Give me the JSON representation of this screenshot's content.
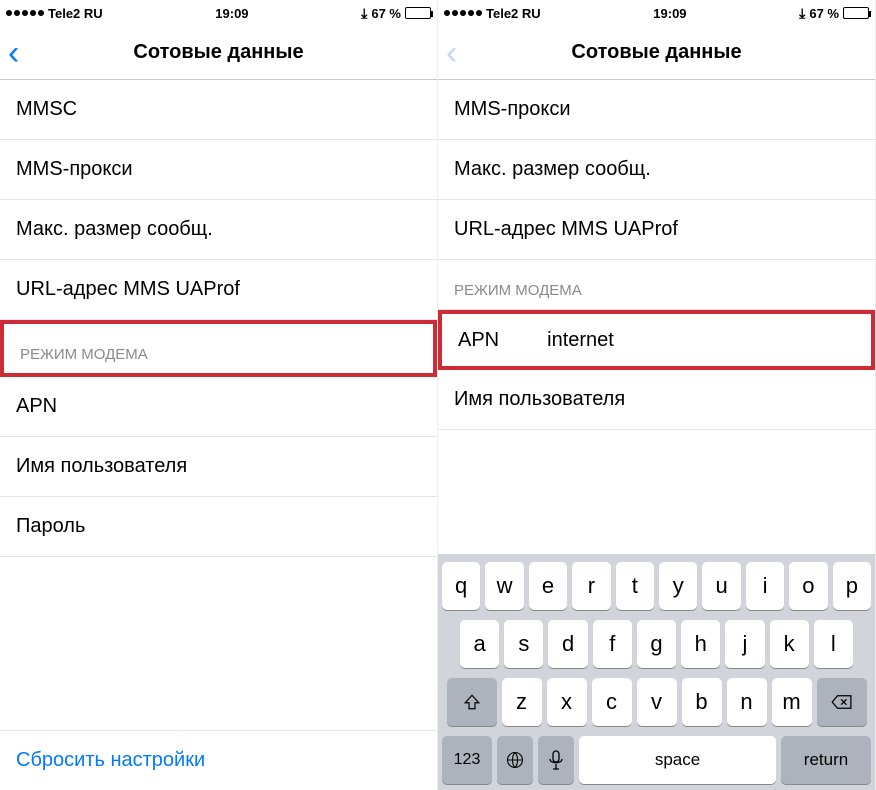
{
  "status": {
    "carrier": "Tele2 RU",
    "time": "19:09",
    "battery": "67 %"
  },
  "nav": {
    "title": "Сотовые данные"
  },
  "left": {
    "rows": {
      "mmsc": "MMSC",
      "mms_proxy": "MMS-прокси",
      "max_msg": "Макс. размер сообщ.",
      "url_uaprof": "URL-адрес MMS UAProf"
    },
    "section_modem": "РЕЖИМ МОДЕМА",
    "modem_rows": {
      "apn": "APN",
      "username": "Имя пользователя",
      "password": "Пароль"
    },
    "reset": "Сбросить настройки"
  },
  "right": {
    "rows": {
      "mms_proxy": "MMS-прокси",
      "max_msg": "Макс. размер сообщ.",
      "url_uaprof": "URL-адрес MMS UAProf"
    },
    "section_modem": "РЕЖИМ МОДЕМА",
    "apn_label": "APN",
    "apn_value": "internet",
    "username": "Имя пользователя"
  },
  "keyboard": {
    "r1": [
      "q",
      "w",
      "e",
      "r",
      "t",
      "y",
      "u",
      "i",
      "o",
      "p"
    ],
    "r2": [
      "a",
      "s",
      "d",
      "f",
      "g",
      "h",
      "j",
      "k",
      "l"
    ],
    "r3": [
      "z",
      "x",
      "c",
      "v",
      "b",
      "n",
      "m"
    ],
    "num": "123",
    "space": "space",
    "return": "return"
  }
}
